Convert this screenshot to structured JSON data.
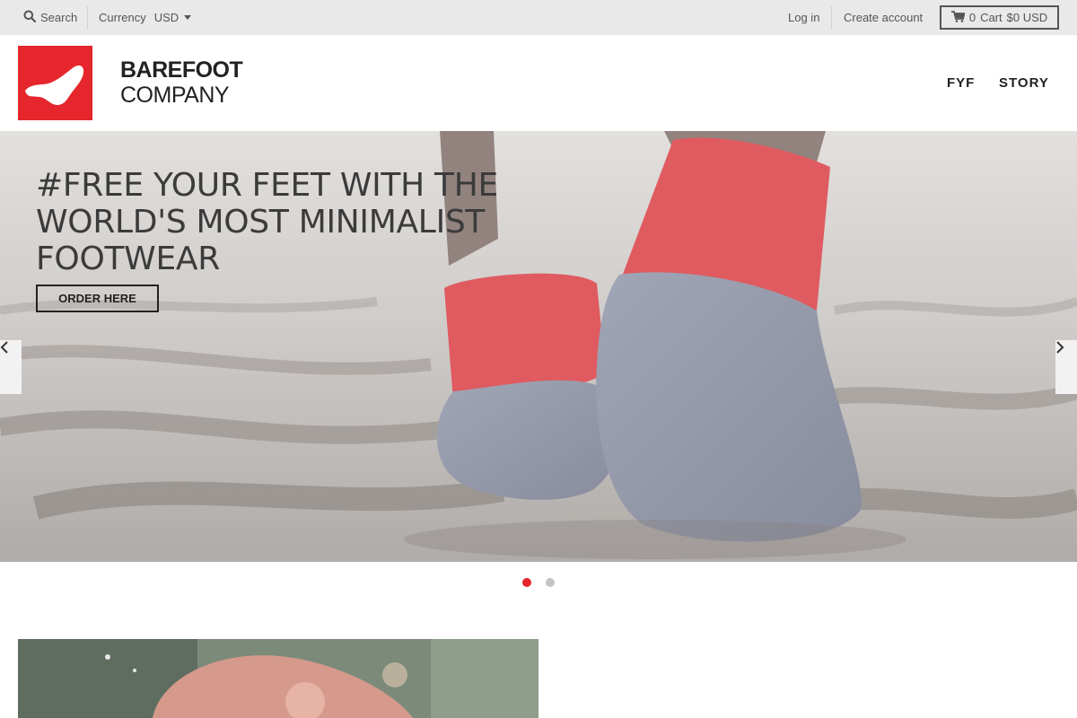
{
  "topbar": {
    "search_label": "Search",
    "currency_label": "Currency",
    "currency_value": "USD",
    "login_label": "Log in",
    "create_account_label": "Create account",
    "cart_count": "0",
    "cart_label": "Cart",
    "cart_total": "$0 USD"
  },
  "brand": {
    "line1": "BAREFOOT",
    "line2": "COMPANY",
    "logo_color": "#e5262c"
  },
  "nav": {
    "items": [
      {
        "label": "FYF"
      },
      {
        "label": "STORY"
      }
    ]
  },
  "hero": {
    "title": "#FREE YOUR FEET WITH THE WORLD'S MOST MINIMALIST FOOTWEAR",
    "cta_label": "ORDER HERE"
  },
  "slider": {
    "active_slide": 1,
    "slide_count": 2,
    "active_color": "#e5262c",
    "inactive_color": "#c4c4c4"
  },
  "icons": [
    "search-icon",
    "caret-down-icon",
    "cart-icon",
    "chevron-left-icon",
    "chevron-right-icon"
  ]
}
